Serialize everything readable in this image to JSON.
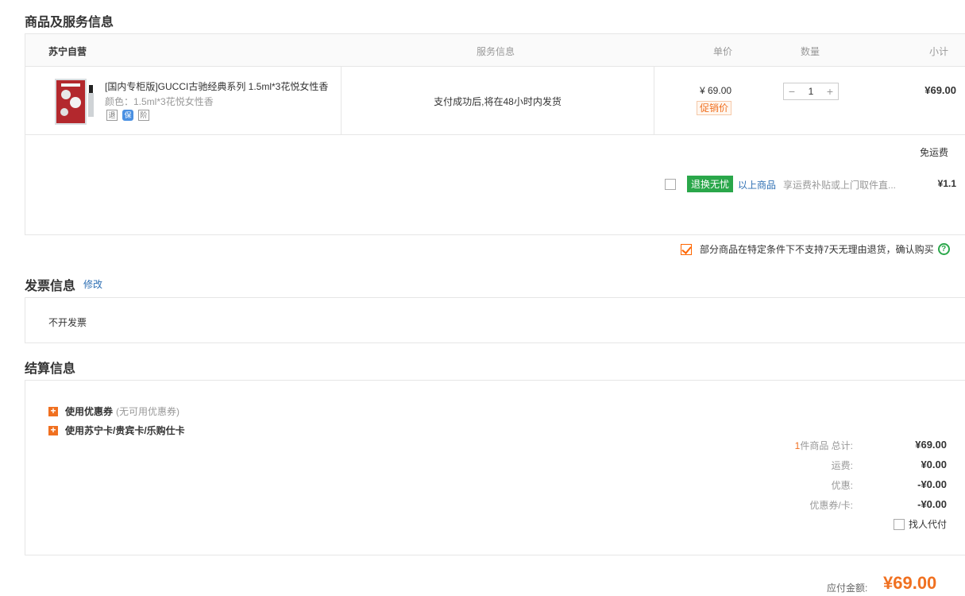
{
  "sections": {
    "goods_title": "商品及服务信息",
    "invoice_title": "发票信息",
    "invoice_edit": "修改",
    "settle_title": "结算信息"
  },
  "table_header": {
    "store": "苏宁自营",
    "service": "服务信息",
    "unit_price": "单价",
    "quantity": "数量",
    "subtotal": "小计"
  },
  "product": {
    "name": "[国内专柜版]GUCCI古驰经典系列 1.5ml*3花悦女性香",
    "color_label": "颜色：1.5ml*3花悦女性香",
    "service_icons": [
      "退",
      "保",
      "阶"
    ],
    "service_text": "支付成功后,将在48小时内发货",
    "price": "¥ 69.00",
    "promo_tag": "促销价",
    "qty": "1",
    "qty_minus": "−",
    "qty_plus": "+",
    "subtotal": "¥69.00"
  },
  "shipping": {
    "label": "免运费",
    "return_tag": "退换无忧",
    "return_scope": "以上商品",
    "return_desc": "享运费补贴或上门取件直...",
    "return_price": "¥1.1"
  },
  "notice": {
    "text": "部分商品在特定条件下不支持7天无理由退货，确认购买",
    "help": "?"
  },
  "invoice": {
    "value": "不开发票"
  },
  "settle": {
    "coupon_label": "使用优惠券",
    "coupon_note": "(无可用优惠券)",
    "card_label": "使用苏宁卡/贵宾卡/乐购仕卡",
    "items_count": "1",
    "items_label": "件商品 总计:",
    "items_total": "¥69.00",
    "freight_label": "运费:",
    "freight_value": "¥0.00",
    "discount_label": "优惠:",
    "discount_value": "-¥0.00",
    "coupon_card_label": "优惠券/卡:",
    "coupon_card_value": "-¥0.00",
    "proxy_pay": "找人代付",
    "payable_label": "应付金额:",
    "payable_value": "¥69.00"
  },
  "colors": {
    "accent": "#f07020",
    "link": "#2e6fb3",
    "green": "#2aa74a"
  }
}
